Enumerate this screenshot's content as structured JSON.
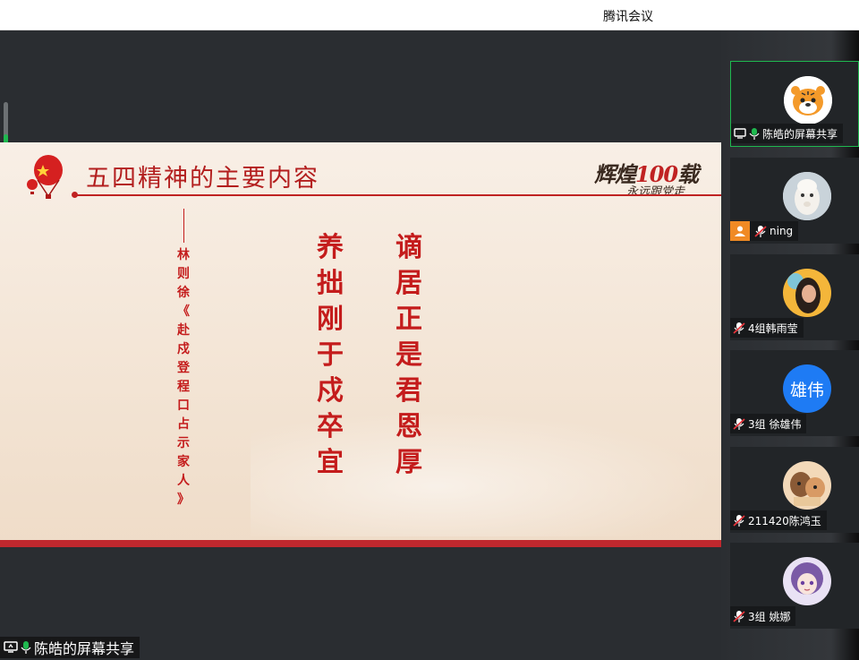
{
  "window": {
    "title": "腾讯会议"
  },
  "slide": {
    "title": "五四精神的主要内容",
    "brand_main": "辉煌",
    "brand_number": "100",
    "brand_suffix": "载",
    "brand_sub": "永远跟党走",
    "author_chars": [
      "林",
      "则",
      "徐",
      "《",
      "赴",
      "戍",
      "登",
      "程",
      "口",
      "占",
      "示",
      "家",
      "人",
      "》"
    ],
    "poem_line_1": [
      "养",
      "拙",
      "刚",
      "于",
      "戍",
      "卒",
      "宜"
    ],
    "poem_line_2": [
      "谪",
      "居",
      "正",
      "是",
      "君",
      "恩",
      "厚"
    ]
  },
  "share_label": "陈皓的屏幕共享",
  "participants": [
    {
      "name": "陈皓的屏幕共享",
      "avatar": "tiger-avatar-icon",
      "mic": "mic-on",
      "sharing": true,
      "active": true
    },
    {
      "name": "ning",
      "avatar": "alpaca-avatar-icon",
      "mic": "mic-off",
      "person_badge": true
    },
    {
      "name": "4组韩雨莹",
      "avatar": "girl-photo-avatar-icon",
      "mic": "mic-off"
    },
    {
      "name": "3组 徐雄伟",
      "avatar_text": "雄伟",
      "avatar_color": "#1e7bf4",
      "mic": "mic-off"
    },
    {
      "name": "211420陈鸿玉",
      "avatar": "cartoon-avatar-icon",
      "mic": "mic-off"
    },
    {
      "name": "3组 姚娜",
      "avatar": "anime-avatar-icon",
      "mic": "mic-off"
    }
  ],
  "colors": {
    "accent": "#1fb84f",
    "slide_red": "#c41c1c",
    "avatar_blue": "#1e7bf4"
  }
}
